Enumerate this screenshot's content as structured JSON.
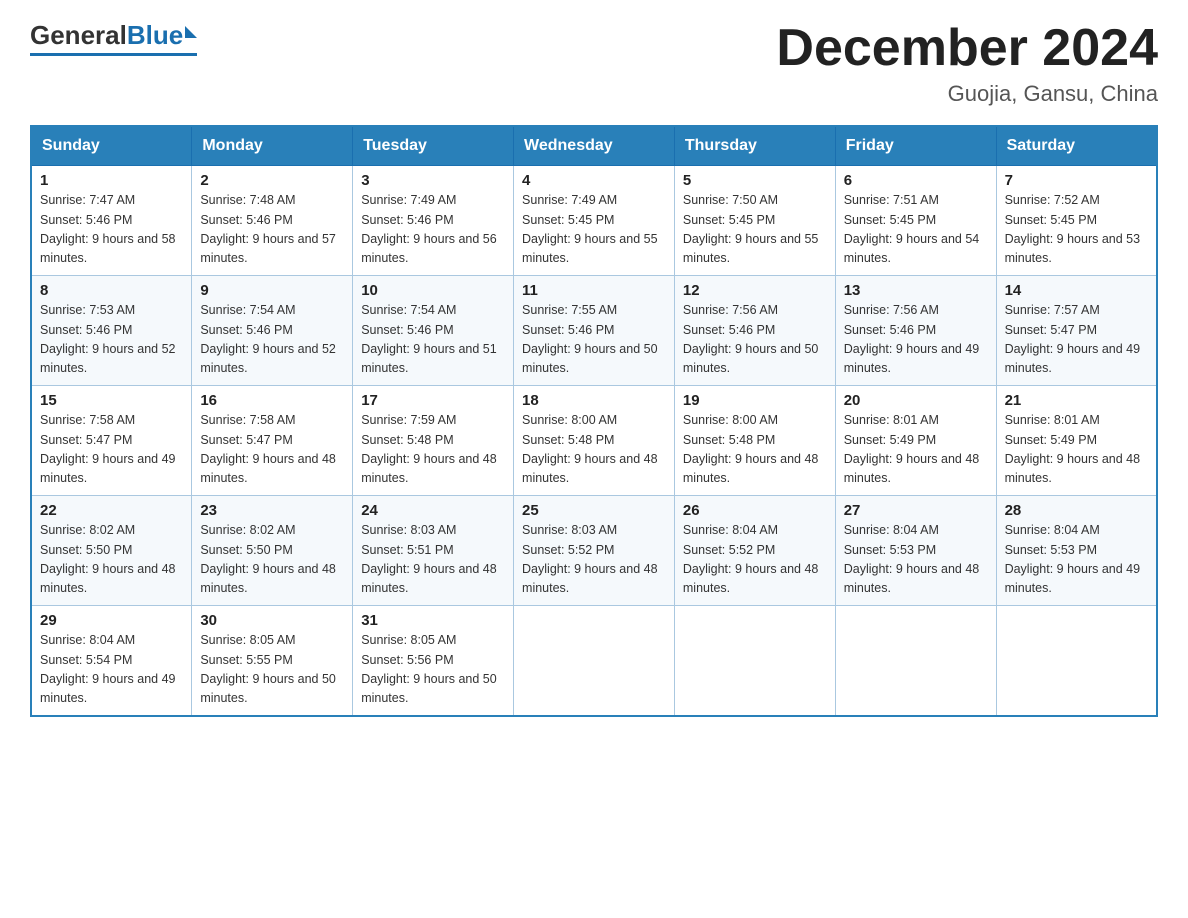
{
  "header": {
    "logo": {
      "general": "General",
      "blue": "Blue"
    },
    "title": "December 2024",
    "location": "Guojia, Gansu, China"
  },
  "days_of_week": [
    "Sunday",
    "Monday",
    "Tuesday",
    "Wednesday",
    "Thursday",
    "Friday",
    "Saturday"
  ],
  "weeks": [
    [
      {
        "day": "1",
        "sunrise": "7:47 AM",
        "sunset": "5:46 PM",
        "daylight": "9 hours and 58 minutes."
      },
      {
        "day": "2",
        "sunrise": "7:48 AM",
        "sunset": "5:46 PM",
        "daylight": "9 hours and 57 minutes."
      },
      {
        "day": "3",
        "sunrise": "7:49 AM",
        "sunset": "5:46 PM",
        "daylight": "9 hours and 56 minutes."
      },
      {
        "day": "4",
        "sunrise": "7:49 AM",
        "sunset": "5:45 PM",
        "daylight": "9 hours and 55 minutes."
      },
      {
        "day": "5",
        "sunrise": "7:50 AM",
        "sunset": "5:45 PM",
        "daylight": "9 hours and 55 minutes."
      },
      {
        "day": "6",
        "sunrise": "7:51 AM",
        "sunset": "5:45 PM",
        "daylight": "9 hours and 54 minutes."
      },
      {
        "day": "7",
        "sunrise": "7:52 AM",
        "sunset": "5:45 PM",
        "daylight": "9 hours and 53 minutes."
      }
    ],
    [
      {
        "day": "8",
        "sunrise": "7:53 AM",
        "sunset": "5:46 PM",
        "daylight": "9 hours and 52 minutes."
      },
      {
        "day": "9",
        "sunrise": "7:54 AM",
        "sunset": "5:46 PM",
        "daylight": "9 hours and 52 minutes."
      },
      {
        "day": "10",
        "sunrise": "7:54 AM",
        "sunset": "5:46 PM",
        "daylight": "9 hours and 51 minutes."
      },
      {
        "day": "11",
        "sunrise": "7:55 AM",
        "sunset": "5:46 PM",
        "daylight": "9 hours and 50 minutes."
      },
      {
        "day": "12",
        "sunrise": "7:56 AM",
        "sunset": "5:46 PM",
        "daylight": "9 hours and 50 minutes."
      },
      {
        "day": "13",
        "sunrise": "7:56 AM",
        "sunset": "5:46 PM",
        "daylight": "9 hours and 49 minutes."
      },
      {
        "day": "14",
        "sunrise": "7:57 AM",
        "sunset": "5:47 PM",
        "daylight": "9 hours and 49 minutes."
      }
    ],
    [
      {
        "day": "15",
        "sunrise": "7:58 AM",
        "sunset": "5:47 PM",
        "daylight": "9 hours and 49 minutes."
      },
      {
        "day": "16",
        "sunrise": "7:58 AM",
        "sunset": "5:47 PM",
        "daylight": "9 hours and 48 minutes."
      },
      {
        "day": "17",
        "sunrise": "7:59 AM",
        "sunset": "5:48 PM",
        "daylight": "9 hours and 48 minutes."
      },
      {
        "day": "18",
        "sunrise": "8:00 AM",
        "sunset": "5:48 PM",
        "daylight": "9 hours and 48 minutes."
      },
      {
        "day": "19",
        "sunrise": "8:00 AM",
        "sunset": "5:48 PM",
        "daylight": "9 hours and 48 minutes."
      },
      {
        "day": "20",
        "sunrise": "8:01 AM",
        "sunset": "5:49 PM",
        "daylight": "9 hours and 48 minutes."
      },
      {
        "day": "21",
        "sunrise": "8:01 AM",
        "sunset": "5:49 PM",
        "daylight": "9 hours and 48 minutes."
      }
    ],
    [
      {
        "day": "22",
        "sunrise": "8:02 AM",
        "sunset": "5:50 PM",
        "daylight": "9 hours and 48 minutes."
      },
      {
        "day": "23",
        "sunrise": "8:02 AM",
        "sunset": "5:50 PM",
        "daylight": "9 hours and 48 minutes."
      },
      {
        "day": "24",
        "sunrise": "8:03 AM",
        "sunset": "5:51 PM",
        "daylight": "9 hours and 48 minutes."
      },
      {
        "day": "25",
        "sunrise": "8:03 AM",
        "sunset": "5:52 PM",
        "daylight": "9 hours and 48 minutes."
      },
      {
        "day": "26",
        "sunrise": "8:04 AM",
        "sunset": "5:52 PM",
        "daylight": "9 hours and 48 minutes."
      },
      {
        "day": "27",
        "sunrise": "8:04 AM",
        "sunset": "5:53 PM",
        "daylight": "9 hours and 48 minutes."
      },
      {
        "day": "28",
        "sunrise": "8:04 AM",
        "sunset": "5:53 PM",
        "daylight": "9 hours and 49 minutes."
      }
    ],
    [
      {
        "day": "29",
        "sunrise": "8:04 AM",
        "sunset": "5:54 PM",
        "daylight": "9 hours and 49 minutes."
      },
      {
        "day": "30",
        "sunrise": "8:05 AM",
        "sunset": "5:55 PM",
        "daylight": "9 hours and 50 minutes."
      },
      {
        "day": "31",
        "sunrise": "8:05 AM",
        "sunset": "5:56 PM",
        "daylight": "9 hours and 50 minutes."
      },
      null,
      null,
      null,
      null
    ]
  ]
}
